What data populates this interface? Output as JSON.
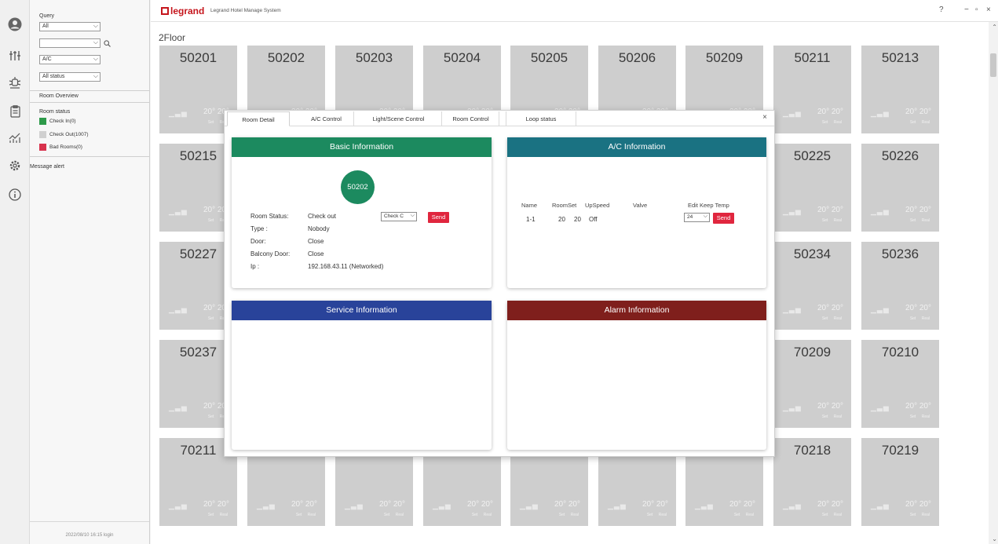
{
  "app": {
    "brand": "legrand",
    "title": "Legrand Hotel Manage System",
    "floor_label": "2Floor"
  },
  "window_controls": {
    "help": "?",
    "minimize": "−",
    "restore": "▫",
    "close": "×"
  },
  "sidebar_icons": [
    "user-icon",
    "sliders-icon",
    "bug-icon",
    "clipboard-icon",
    "chart-icon",
    "gear-icon",
    "info-icon"
  ],
  "filter_panel": {
    "query_label": "Query",
    "select_all": "All",
    "select_blank": "",
    "select_ac": "A/C",
    "select_status": "All status",
    "room_overview_label": "Room Overview",
    "room_status_label": "Room status",
    "legend": [
      {
        "label": "Check In(0)",
        "color": "#2e9a4a"
      },
      {
        "label": "Check Out(1007)",
        "color": "#d0d0d0"
      },
      {
        "label": "Bad Rooms(0)",
        "color": "#d8324d"
      }
    ],
    "message_alert_label": "Message alert",
    "login_text": "2022/08/10 16:15 login"
  },
  "tile_labels": {
    "temp": "20°",
    "set_label": "Set",
    "real_label": "Real"
  },
  "rooms": [
    "50201",
    "50202",
    "50203",
    "50204",
    "50205",
    "50206",
    "50209",
    "50211",
    "50213",
    "50215",
    "50225",
    "50226",
    "50227",
    "50234",
    "50236",
    "50237",
    "70209",
    "70210",
    "70211",
    "70218",
    "70219"
  ],
  "dialog": {
    "tabs": [
      "Room Detail",
      "A/C Control",
      "Light/Scene Control",
      "Room Control",
      "Loop status"
    ],
    "active_tab": "Room Detail",
    "close": "×",
    "basic": {
      "title": "Basic Information",
      "room_number": "50202",
      "fields": [
        {
          "key": "Room Status:",
          "value": "Check out"
        },
        {
          "key": "Type :",
          "value": "Nobody"
        },
        {
          "key": "Door:",
          "value": "Close"
        },
        {
          "key": "Balcony Door:",
          "value": "Close"
        },
        {
          "key": "Ip :",
          "value": "192.168.43.11 (Networked)"
        }
      ],
      "status_select": "Check C",
      "send_label": "Send"
    },
    "ac": {
      "title": "A/C Information",
      "headers": [
        "Name",
        "RoomSet",
        "UpSpeed",
        "Valve",
        "Edit Keep Temp"
      ],
      "row": {
        "name": "1-1",
        "room": "20",
        "set": "20",
        "speed": "Off"
      },
      "temp_select": "24",
      "send_label": "Send"
    },
    "service": {
      "title": "Service Information"
    },
    "alarm": {
      "title": "Alarm Information"
    }
  },
  "colors": {
    "basic_header": "#1c8a5f",
    "ac_header": "#1a7282",
    "service_header": "#29439a",
    "alarm_header": "#7f1f1c",
    "send_button": "#e0263e",
    "tile": "#cecece"
  }
}
